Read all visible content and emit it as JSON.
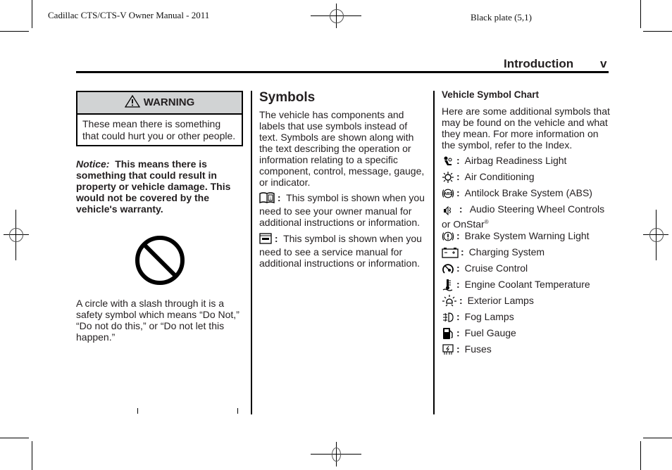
{
  "header": {
    "manual_title": "Cadillac CTS/CTS-V Owner Manual - 2011",
    "plate": "Black plate (5,1)",
    "section": "Introduction",
    "page_number": "v"
  },
  "left": {
    "warning": {
      "icon": "warning-triangle-icon",
      "title": "WARNING",
      "body": "These mean there is something that could hurt you or other people."
    },
    "notice": {
      "label": "Notice:",
      "text": "This means there is something that could result in property or vehicle damage. This would not be covered by the vehicle's warranty."
    },
    "prohibition_icon": "circle-slash-icon",
    "prohibition_text": "A circle with a slash through it is a safety symbol which means “Do Not,” “Do not do this,” or “Do not let this happen.”"
  },
  "middle": {
    "heading": "Symbols",
    "intro": "The vehicle has components and labels that use symbols instead of text. Symbols are shown along with the text describing the operation or information relating to a specific component, control, message, gauge, or indicator.",
    "items": [
      {
        "icon": "owner-manual-book-icon",
        "text": "This symbol is shown when you need to see your owner manual for additional instructions or information."
      },
      {
        "icon": "service-manual-icon",
        "text": "This symbol is shown when you need to see a service manual for additional instructions or information."
      }
    ]
  },
  "right": {
    "heading": "Vehicle Symbol Chart",
    "intro": "Here are some additional symbols that may be found on the vehicle and what they mean. For more information on the symbol, refer to the Index.",
    "symbols": [
      {
        "icon": "airbag-icon",
        "label": "Airbag Readiness Light"
      },
      {
        "icon": "air-conditioning-icon",
        "label": "Air Conditioning"
      },
      {
        "icon": "abs-icon",
        "label": "Antilock Brake System (ABS)"
      },
      {
        "icon": "audio-steering-icon",
        "label": "Audio Steering Wheel Controls or OnStar",
        "sup": "®"
      },
      {
        "icon": "brake-warning-icon",
        "label": "Brake System Warning Light"
      },
      {
        "icon": "battery-icon",
        "label": "Charging System"
      },
      {
        "icon": "cruise-control-icon",
        "label": "Cruise Control"
      },
      {
        "icon": "coolant-temperature-icon",
        "label": "Engine Coolant Temperature"
      },
      {
        "icon": "exterior-lamps-icon",
        "label": "Exterior Lamps"
      },
      {
        "icon": "fog-lamps-icon",
        "label": "Fog Lamps"
      },
      {
        "icon": "fuel-gauge-icon",
        "label": "Fuel Gauge"
      },
      {
        "icon": "fuses-icon",
        "label": "Fuses"
      }
    ]
  },
  "colon": ":"
}
